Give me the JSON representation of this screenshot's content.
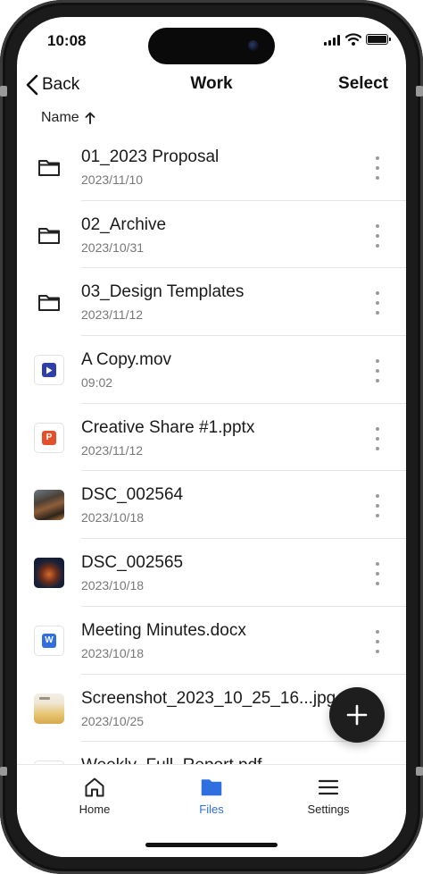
{
  "status": {
    "time": "10:08"
  },
  "nav": {
    "back_label": "Back",
    "title": "Work",
    "select_label": "Select"
  },
  "sort": {
    "label": "Name",
    "direction_icon": "arrow-up-icon"
  },
  "files": [
    {
      "name": "01_2023 Proposal",
      "meta": "2023/11/10",
      "kind": "folder"
    },
    {
      "name": "02_Archive",
      "meta": "2023/10/31",
      "kind": "folder"
    },
    {
      "name": "03_Design Templates",
      "meta": "2023/11/12",
      "kind": "folder"
    },
    {
      "name": "A Copy.mov",
      "meta": "09:02",
      "kind": "video",
      "color": "#2f3fa8"
    },
    {
      "name": "Creative Share #1.pptx",
      "meta": "2023/11/12",
      "kind": "pptx",
      "badge": "P",
      "color": "#e2512c"
    },
    {
      "name": "DSC_002564",
      "meta": "2023/10/18",
      "kind": "image"
    },
    {
      "name": "DSC_002565",
      "meta": "2023/10/18",
      "kind": "image"
    },
    {
      "name": "Meeting Minutes.docx",
      "meta": "2023/10/18",
      "kind": "docx",
      "badge": "W",
      "color": "#2f6fe0"
    },
    {
      "name": "Screenshot_2023_10_25_16...jpg",
      "meta": "2023/10/25",
      "kind": "image"
    },
    {
      "name": "Weekly_Full_Report.pdf",
      "meta": "",
      "kind": "pdf"
    }
  ],
  "tabs": [
    {
      "label": "Home",
      "icon": "home-icon"
    },
    {
      "label": "Files",
      "icon": "folder-icon"
    },
    {
      "label": "Settings",
      "icon": "menu-icon"
    }
  ],
  "colors": {
    "accent": "#2f6fe0",
    "fab": "#1e1e1e"
  }
}
